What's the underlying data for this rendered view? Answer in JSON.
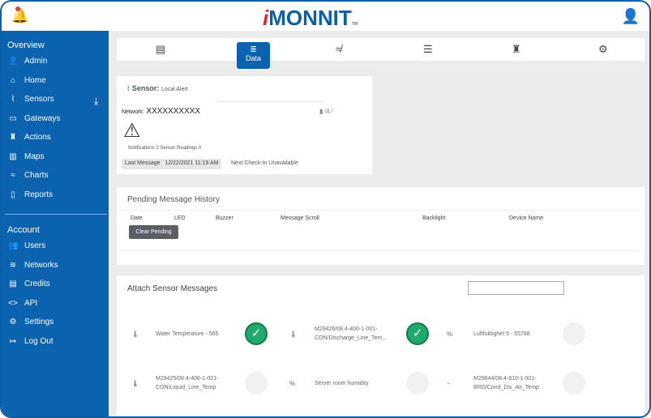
{
  "header": {
    "logo": "MONNIT",
    "logo_i": "i",
    "logo_tm": "TM"
  },
  "sidebar": {
    "overview_label": "Overview",
    "overview_items": [
      {
        "label": "Admin",
        "icon": "👤"
      },
      {
        "label": "Home",
        "icon": "⌂"
      },
      {
        "label": "Sensors",
        "icon": "⌇"
      },
      {
        "label": "Gateways",
        "icon": "▭"
      },
      {
        "label": "Actions",
        "icon": "♜"
      },
      {
        "label": "Maps",
        "icon": "▥"
      },
      {
        "label": "Charts",
        "icon": "≈"
      },
      {
        "label": "Reports",
        "icon": "▯"
      }
    ],
    "account_label": "Account",
    "account_items": [
      {
        "label": "Users",
        "icon": "👥"
      },
      {
        "label": "Networks",
        "icon": "≋"
      },
      {
        "label": "Credits",
        "icon": "▤"
      },
      {
        "label": "API",
        "icon": "<>"
      },
      {
        "label": "Settings",
        "icon": "⚙"
      },
      {
        "label": "Log Out",
        "icon": "↦"
      }
    ],
    "download_icon": "⤓"
  },
  "tabs": {
    "active_label": "Data"
  },
  "sensor": {
    "label": "Sensor:",
    "name": "Local Alert",
    "network_label": "Network:",
    "network": "XXXXXXXXXX",
    "notifications": "Notifications 2 Sensor Readings 0",
    "last_message_label": "Last Message",
    "last_message": "12/22/2021 11:19 AM",
    "next_checkin": "Next Check-In Unavailable"
  },
  "pending": {
    "title": "Pending Message History",
    "columns": [
      "Date",
      "LED",
      "Buzzer",
      "Message Scroll",
      "Backlight",
      "Device Name"
    ],
    "clear_button": "Clear Pending"
  },
  "attach": {
    "title": "Attach Sensor Messages",
    "search_value": "",
    "rows": [
      [
        {
          "icon": "🌡",
          "name": "Water Temperature - 565",
          "checked": true
        },
        {
          "icon": "🌡",
          "name": "M29426/08.4-400-1-001-CON/Discharge_Line_Tem...",
          "checked": true
        },
        {
          "icon": "%",
          "name": "Luftfuktighet 5 - 55788",
          "checked": false
        }
      ],
      [
        {
          "icon": "🌡",
          "name": "M29425/08.4-400-1-001-CON/Liquid_Line_Temp",
          "checked": false
        },
        {
          "icon": "%",
          "name": "Server room humidity",
          "checked": false
        },
        {
          "icon": "~",
          "name": "M29644/08.4-810-1-001-BRD/Cond_Dis_Air_Temp",
          "checked": false
        }
      ]
    ]
  }
}
